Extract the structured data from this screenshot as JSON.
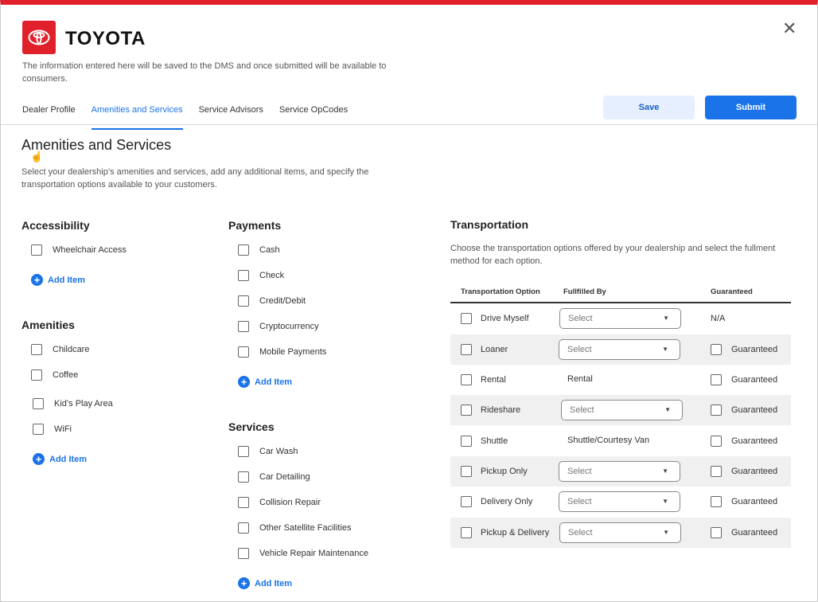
{
  "brand": {
    "name": "TOYOTA",
    "accent": "#e0202a",
    "primary": "#1a73e8"
  },
  "intro": "The information entered here will be saved to the DMS and once submitted will be available to consumers.",
  "tabs": [
    "Dealer Profile",
    "Amenities and Services",
    "Service Advisors",
    "Service OpCodes"
  ],
  "active_tab": "Amenities and Services",
  "actions": {
    "save": "Save",
    "submit": "Submit"
  },
  "page": {
    "title": "Amenities and Services",
    "description": "Select your dealership’s amenities and services, add any additional items, and specify the transportation options available to your customers."
  },
  "add_item_label": "Add Item",
  "accessibility": {
    "title": "Accessibility",
    "items": [
      "Wheelchair Access"
    ]
  },
  "amenities": {
    "title": "Amenities",
    "items": [
      "Childcare",
      "Coffee",
      "Kid’s Play Area",
      "WiFi"
    ]
  },
  "payments": {
    "title": "Payments",
    "items": [
      "Cash",
      "Check",
      "Credit/Debit",
      "Cryptocurrency",
      "Mobile Payments"
    ]
  },
  "services": {
    "title": "Services",
    "items": [
      "Car Wash",
      "Car Detailing",
      "Collision Repair",
      "Other Satellite Facilities",
      "Vehicle Repair Maintenance"
    ]
  },
  "transportation": {
    "title": "Transportation",
    "description": "Choose the transportation options offered by your dealership and select the fullment method for each option.",
    "headers": [
      "Transportation Option",
      "Fullfilled By",
      "Guaranteed"
    ],
    "rows": [
      {
        "option": "Drive Myself",
        "fulfilled": "Select",
        "type": "select",
        "guaranteed": "N/A"
      },
      {
        "option": "Loaner",
        "fulfilled": "Select",
        "type": "select",
        "guaranteed": "Guaranteed"
      },
      {
        "option": "Rental",
        "fulfilled": "Rental",
        "type": "text",
        "guaranteed": "Guaranteed"
      },
      {
        "option": "Rideshare",
        "fulfilled": "Select",
        "type": "select",
        "guaranteed": "Guaranteed"
      },
      {
        "option": "Shuttle",
        "fulfilled": "Shuttle/Courtesy Van",
        "type": "text",
        "guaranteed": "Guaranteed"
      },
      {
        "option": "Pickup Only",
        "fulfilled": "Select",
        "type": "select",
        "guaranteed": "Guaranteed"
      },
      {
        "option": "Delivery Only",
        "fulfilled": "Select",
        "type": "select",
        "guaranteed": "Guaranteed"
      },
      {
        "option": "Pickup & Delivery",
        "fulfilled": "Select",
        "type": "select",
        "guaranteed": "Guaranteed"
      }
    ]
  }
}
